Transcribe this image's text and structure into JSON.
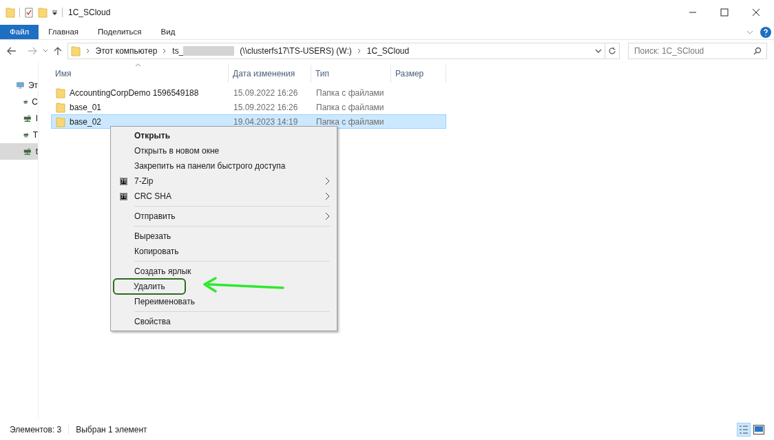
{
  "window": {
    "title": "1C_SCloud"
  },
  "ribbon_tabs": [
    {
      "label": "Файл",
      "selected": true
    },
    {
      "label": "Главная",
      "selected": false
    },
    {
      "label": "Поделиться",
      "selected": false
    },
    {
      "label": "Вид",
      "selected": false
    }
  ],
  "address_bar": {
    "crumbs": [
      {
        "label": "Этот компьютер",
        "kind": "text"
      },
      {
        "label": "ts_",
        "kind": "text"
      },
      {
        "kind": "redacted"
      },
      {
        "label": "(\\\\clusterfs17\\TS-USERS) (W:)",
        "kind": "text"
      },
      {
        "label": "1C_SCloud",
        "kind": "text"
      }
    ]
  },
  "search": {
    "placeholder": "Поиск: 1C_SCloud"
  },
  "sidebar": {
    "items": [
      {
        "label": "Эт",
        "kind": "computer",
        "selected": false
      },
      {
        "label": "С",
        "kind": "drive",
        "selected": false
      },
      {
        "label": "I",
        "kind": "drive",
        "selected": false
      },
      {
        "label": "Т",
        "kind": "drive",
        "selected": false
      },
      {
        "label": "t",
        "kind": "drive",
        "selected": true
      }
    ]
  },
  "table": {
    "columns": [
      "Имя",
      "Дата изменения",
      "Тип",
      "Размер"
    ],
    "rows": [
      {
        "name": "AccountingCorpDemo 1596549188",
        "date": "15.09.2022 16:26",
        "type": "Папка с файлами",
        "selected": false
      },
      {
        "name": "base_01",
        "date": "15.09.2022 16:26",
        "type": "Папка с файлами",
        "selected": false
      },
      {
        "name": "base_02",
        "date": "19.04.2023 14:19",
        "type": "Папка с файлами",
        "selected": true
      }
    ]
  },
  "context_menu": {
    "items": [
      {
        "kind": "item",
        "label": "Открыть",
        "default": true,
        "icon": false,
        "submenu": false,
        "highlighted": false
      },
      {
        "kind": "item",
        "label": "Открыть в новом окне",
        "default": false,
        "icon": false,
        "submenu": false,
        "highlighted": false
      },
      {
        "kind": "item",
        "label": "Закрепить на панели быстрого доступа",
        "default": false,
        "icon": false,
        "submenu": false,
        "highlighted": false
      },
      {
        "kind": "item",
        "label": "7-Zip",
        "default": false,
        "icon": true,
        "submenu": true,
        "highlighted": false
      },
      {
        "kind": "item",
        "label": "CRC SHA",
        "default": false,
        "icon": true,
        "submenu": true,
        "highlighted": false
      },
      {
        "kind": "separator"
      },
      {
        "kind": "item",
        "label": "Отправить",
        "default": false,
        "icon": false,
        "submenu": true,
        "highlighted": false
      },
      {
        "kind": "separator"
      },
      {
        "kind": "item",
        "label": "Вырезать",
        "default": false,
        "icon": false,
        "submenu": false,
        "highlighted": false
      },
      {
        "kind": "item",
        "label": "Копировать",
        "default": false,
        "icon": false,
        "submenu": false,
        "highlighted": false
      },
      {
        "kind": "separator"
      },
      {
        "kind": "item",
        "label": "Создать ярлык",
        "default": false,
        "icon": false,
        "submenu": false,
        "highlighted": false
      },
      {
        "kind": "item",
        "label": "Удалить",
        "default": false,
        "icon": false,
        "submenu": false,
        "highlighted": true
      },
      {
        "kind": "item",
        "label": "Переименовать",
        "default": false,
        "icon": false,
        "submenu": false,
        "highlighted": false
      },
      {
        "kind": "separator"
      },
      {
        "kind": "item",
        "label": "Свойства",
        "default": false,
        "icon": false,
        "submenu": false,
        "highlighted": false
      }
    ]
  },
  "status_bar": {
    "count": "Элементов: 3",
    "selection": "Выбран 1 элемент"
  }
}
